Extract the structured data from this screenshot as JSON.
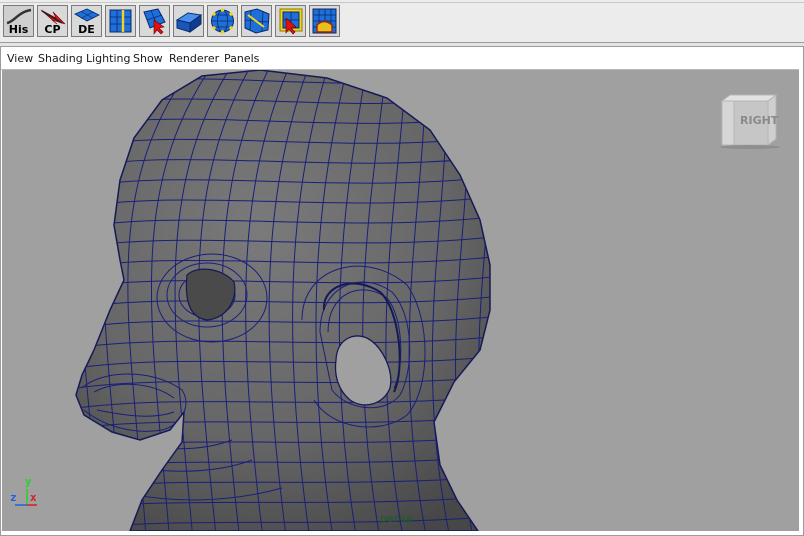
{
  "shelf": {
    "buttons": [
      {
        "name": "history-button",
        "label": "His",
        "icon": "history-curve-icon"
      },
      {
        "name": "center-pivot-button",
        "label": "CP",
        "icon": "red-arrow-icon"
      },
      {
        "name": "delete-edge-button",
        "label": "DE",
        "icon": "blue-plane-icon"
      },
      {
        "name": "insert-edge-loop-button",
        "label": "",
        "icon": "edge-loop-icon"
      },
      {
        "name": "split-polygon-button",
        "label": "",
        "icon": "split-polygon-icon"
      },
      {
        "name": "extrude-face-button",
        "label": "",
        "icon": "extrude-icon"
      },
      {
        "name": "smooth-proxy-button",
        "label": "",
        "icon": "sphere-mesh-icon"
      },
      {
        "name": "sculpt-geometry-button",
        "label": "",
        "icon": "sculpt-icon"
      },
      {
        "name": "select-faces-button",
        "label": "",
        "icon": "select-arrow-icon"
      },
      {
        "name": "uv-editor-button",
        "label": "",
        "icon": "uv-grid-icon"
      }
    ]
  },
  "panel_menu": {
    "view": "View",
    "shading": "Shading",
    "lighting": "Lighting",
    "show": "Show",
    "renderer": "Renderer",
    "panels": "Panels"
  },
  "viewport": {
    "viewcube_face": "RIGHT",
    "camera": "persp",
    "axis": {
      "x": "x",
      "y": "y",
      "z": "z"
    },
    "colors": {
      "background": "#a0a0a0",
      "mesh_fill": "#6b6b6b",
      "wireframe": "#1a1f7a",
      "axis_x": "#d22020",
      "axis_y": "#2ad12a",
      "axis_z": "#2060e0"
    }
  }
}
